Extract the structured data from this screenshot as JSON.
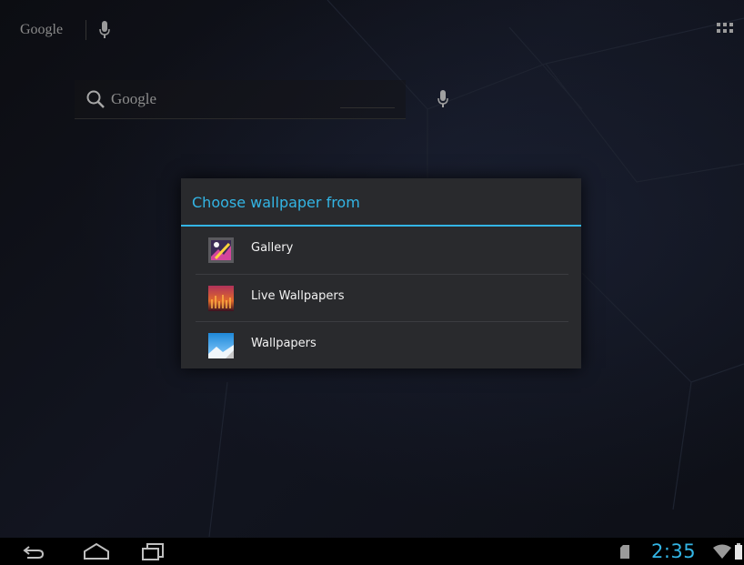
{
  "top_bar": {
    "google_label": "Google"
  },
  "search_widget": {
    "placeholder": "Google"
  },
  "dialog": {
    "title": "Choose wallpaper from",
    "options": [
      {
        "label": "Gallery",
        "icon": "gallery-icon"
      },
      {
        "label": "Live Wallpapers",
        "icon": "live-wallpapers-icon"
      },
      {
        "label": "Wallpapers",
        "icon": "wallpapers-icon"
      }
    ]
  },
  "status_bar": {
    "time": "2:35"
  },
  "colors": {
    "accent": "#33b5e5",
    "dialog_bg": "#292a2d",
    "nav_bg": "#000000"
  }
}
